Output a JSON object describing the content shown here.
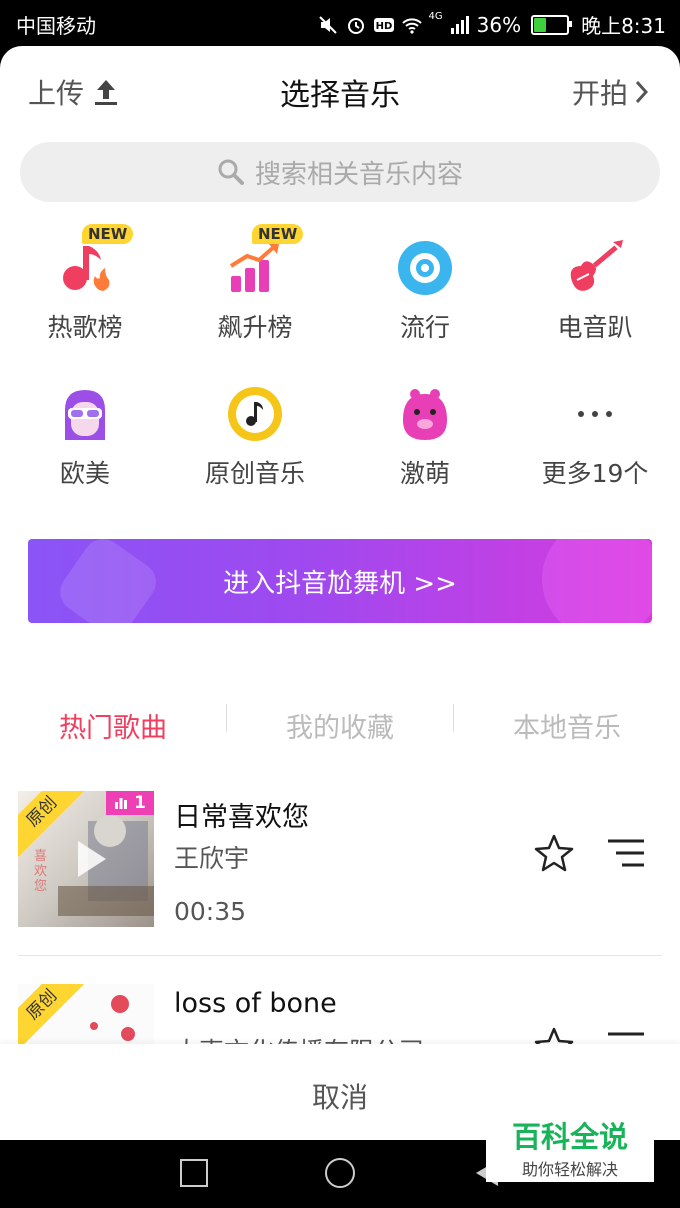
{
  "status_bar": {
    "carrier": "中国移动",
    "network": "4G",
    "battery": "36%",
    "time": "晚上8:31",
    "battery_level": 0.36
  },
  "header": {
    "upload_label": "上传",
    "title": "选择音乐",
    "start_label": "开拍"
  },
  "search": {
    "placeholder": "搜索相关音乐内容"
  },
  "categories": [
    {
      "label": "热歌榜",
      "badge": "NEW",
      "icon": "music-note-flame-icon"
    },
    {
      "label": "飙升榜",
      "badge": "NEW",
      "icon": "rising-chart-icon"
    },
    {
      "label": "流行",
      "icon": "vinyl-disc-icon"
    },
    {
      "label": "电音趴",
      "icon": "electric-guitar-icon"
    },
    {
      "label": "欧美",
      "icon": "sunglasses-face-icon"
    },
    {
      "label": "原创音乐",
      "icon": "music-disc-icon"
    },
    {
      "label": "激萌",
      "icon": "cute-creature-icon"
    },
    {
      "label": "更多19个",
      "icon": "more-dots-icon"
    }
  ],
  "banner": {
    "label": "进入抖音尬舞机 >>"
  },
  "tabs": [
    {
      "label": "热门歌曲",
      "active": true
    },
    {
      "label": "我的收藏",
      "active": false
    },
    {
      "label": "本地音乐",
      "active": false
    }
  ],
  "songs": [
    {
      "title": "日常喜欢您",
      "artist": "王欣宇",
      "duration": "00:35",
      "tag": "原创",
      "rank": "1",
      "cover_text": "喜欢您"
    },
    {
      "title": "loss of bone",
      "artist": "大声文化传播有限公司",
      "tag": "原创"
    }
  ],
  "cancel_label": "取消",
  "watermark": {
    "title": "百科全说",
    "subtitle": "助你轻松解决"
  },
  "colors": {
    "accent": "#ef3e5f",
    "badge": "#ffd531",
    "banner_start": "#8a54f6",
    "banner_end": "#d63bde"
  }
}
